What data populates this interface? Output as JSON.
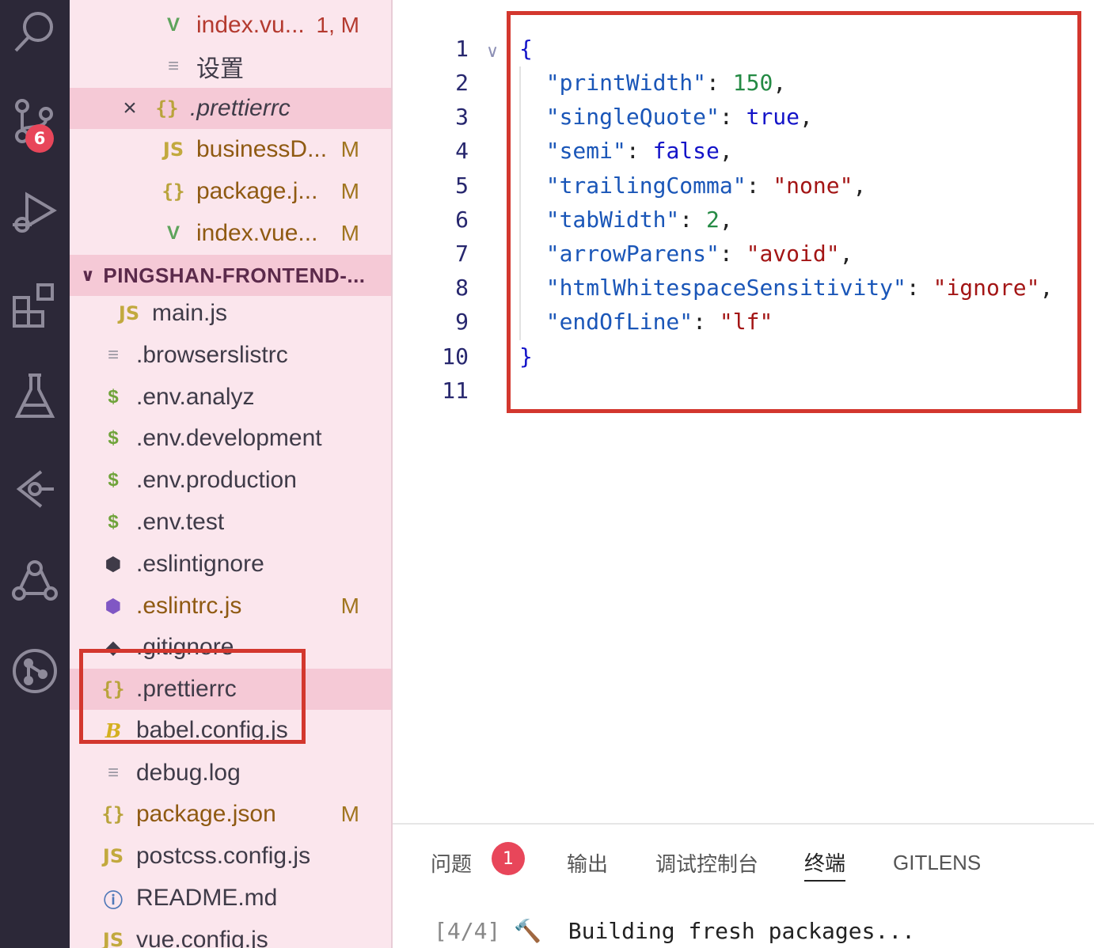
{
  "activity_bar": {
    "icons": [
      "search-icon",
      "source-control-icon",
      "run-debug-icon",
      "extensions-icon",
      "testing-icon",
      "gitlens-icon",
      "live-share-icon",
      "git-graph-icon"
    ],
    "scm_badge": "6"
  },
  "sidebar": {
    "open_editors": [
      {
        "name": "index.vu...",
        "status": "1, M",
        "icon": "vue-icon"
      },
      {
        "name": "设置",
        "status": "",
        "icon": "settings-file-icon"
      },
      {
        "name": ".prettierrc",
        "status": "",
        "icon": "json-braces-icon"
      },
      {
        "name": "businessD...",
        "status": "M",
        "icon": "js-icon"
      },
      {
        "name": "package.j...",
        "status": "M",
        "icon": "json-braces-icon"
      },
      {
        "name": "index.vue...",
        "status": "M",
        "icon": "vue-icon"
      }
    ],
    "section_title": "PINGSHAN-FRONTEND-...",
    "files": [
      {
        "name": "main.js",
        "status": "",
        "icon": "js-icon"
      },
      {
        "name": ".browserslistrc",
        "status": "",
        "icon": "text-lines-icon"
      },
      {
        "name": ".env.analyz",
        "status": "",
        "icon": "dollar-icon"
      },
      {
        "name": ".env.development",
        "status": "",
        "icon": "dollar-icon"
      },
      {
        "name": ".env.production",
        "status": "",
        "icon": "dollar-icon"
      },
      {
        "name": ".env.test",
        "status": "",
        "icon": "dollar-icon"
      },
      {
        "name": ".eslintignore",
        "status": "",
        "icon": "eslint-icon"
      },
      {
        "name": ".eslintrc.js",
        "status": "M",
        "icon": "eslint-icon"
      },
      {
        "name": ".gitignore",
        "status": "",
        "icon": "git-icon"
      },
      {
        "name": ".prettierrc",
        "status": "",
        "icon": "json-braces-icon"
      },
      {
        "name": "babel.config.js",
        "status": "",
        "icon": "babel-icon"
      },
      {
        "name": "debug.log",
        "status": "",
        "icon": "text-lines-icon"
      },
      {
        "name": "package.json",
        "status": "M",
        "icon": "json-braces-icon"
      },
      {
        "name": "postcss.config.js",
        "status": "",
        "icon": "js-icon"
      },
      {
        "name": "README.md",
        "status": "",
        "icon": "info-icon"
      },
      {
        "name": "vue.config.js",
        "status": "",
        "icon": "js-icon"
      }
    ]
  },
  "editor": {
    "line_numbers": [
      "1",
      "2",
      "3",
      "4",
      "5",
      "6",
      "7",
      "8",
      "9",
      "10",
      "11"
    ],
    "open_brace": "{",
    "close_brace": "}",
    "entries": [
      {
        "key": "\"printWidth\"",
        "value": "150",
        "kind": "num",
        "sep": ","
      },
      {
        "key": "\"singleQuote\"",
        "value": "true",
        "kind": "bool",
        "sep": ","
      },
      {
        "key": "\"semi\"",
        "value": "false",
        "kind": "bool",
        "sep": ","
      },
      {
        "key": "\"trailingComma\"",
        "value": "\"none\"",
        "kind": "str",
        "sep": ","
      },
      {
        "key": "\"tabWidth\"",
        "value": "2",
        "kind": "num",
        "sep": ","
      },
      {
        "key": "\"arrowParens\"",
        "value": "\"avoid\"",
        "kind": "str",
        "sep": ","
      },
      {
        "key": "\"htmlWhitespaceSensitivity\"",
        "value": "\"ignore\"",
        "kind": "str",
        "sep": ","
      },
      {
        "key": "\"endOfLine\"",
        "value": "\"lf\"",
        "kind": "str",
        "sep": ""
      }
    ]
  },
  "panel": {
    "tabs": [
      {
        "label": "问题",
        "active": false
      },
      {
        "label": "输出",
        "active": false
      },
      {
        "label": "调试控制台",
        "active": false
      },
      {
        "label": "终端",
        "active": true
      },
      {
        "label": "GITLENS",
        "active": false
      }
    ],
    "problems_badge": "1",
    "terminal_step": "[4/4]",
    "terminal_icon": "🔨",
    "terminal_text": "Building fresh packages..."
  },
  "colors": {
    "highlight_box": "#d3372e",
    "activity_bar_bg": "#2c2838",
    "sidebar_bg": "#fbe6ed",
    "badge": "#e8465a"
  }
}
